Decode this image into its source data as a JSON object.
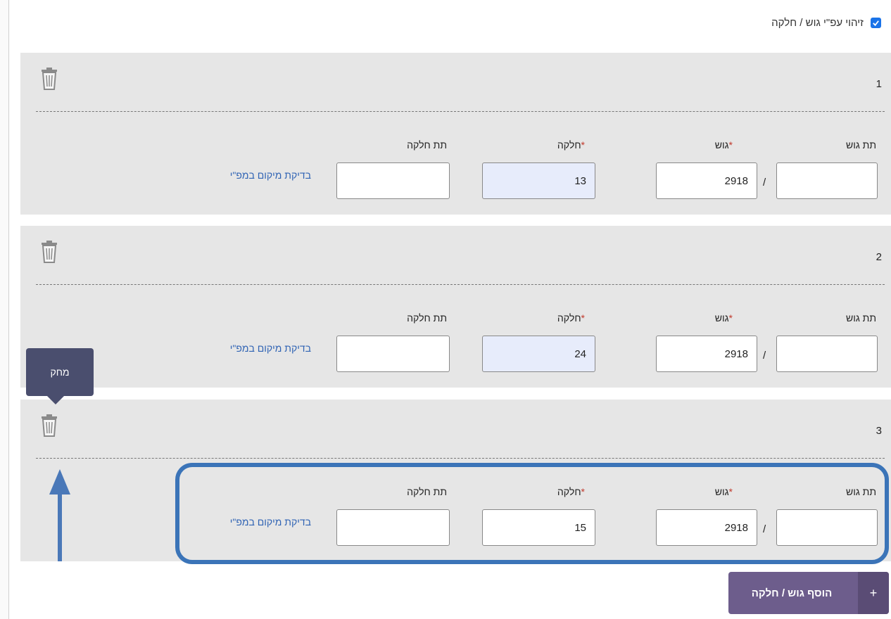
{
  "identify_checkbox": {
    "label": "זיהוי עפ\"י גוש / חלקה",
    "checked": true
  },
  "labels": {
    "tat_gush": "תת גוש",
    "gush": "גוש",
    "helka": "חלקה",
    "tat_helka": "תת חלקה",
    "required_mark": "*",
    "slash": "/",
    "map_link": "בדיקת מיקום במפ\"י"
  },
  "parcels": [
    {
      "number": "1",
      "tat_gush": "",
      "gush": "2918",
      "helka": "13",
      "tat_helka": ""
    },
    {
      "number": "2",
      "tat_gush": "",
      "gush": "2918",
      "helka": "24",
      "tat_helka": ""
    },
    {
      "number": "3",
      "tat_gush": "",
      "gush": "2918",
      "helka": "15",
      "tat_helka": ""
    }
  ],
  "tooltip": {
    "text": "מחק"
  },
  "add_button": {
    "plus": "+",
    "label": "הוסף גוש / חלקה"
  },
  "colors": {
    "accent": "#1a73e8",
    "panel": "#e6e6e6",
    "button": "#6d5d8c",
    "tooltip": "#4a4e6e",
    "annotation": "#3b74b8",
    "required": "#c0392b",
    "link": "#2f63b4"
  },
  "icons": {
    "trash": "trash-icon",
    "check": "check-icon",
    "plus": "plus-icon",
    "annotation_arrow": "arrow-up-icon"
  }
}
